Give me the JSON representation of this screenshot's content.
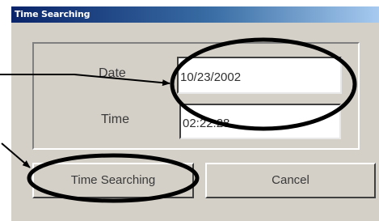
{
  "window": {
    "title": "Time Searching"
  },
  "form": {
    "date_label": "Date",
    "date_value": "10/23/2002",
    "time_label": "Time",
    "time_value": "02:22:28"
  },
  "buttons": {
    "search_label": "Time Searching",
    "cancel_label": "Cancel"
  },
  "annotations": {
    "ellipse_color": "#000000",
    "arrow_color": "#000000"
  }
}
